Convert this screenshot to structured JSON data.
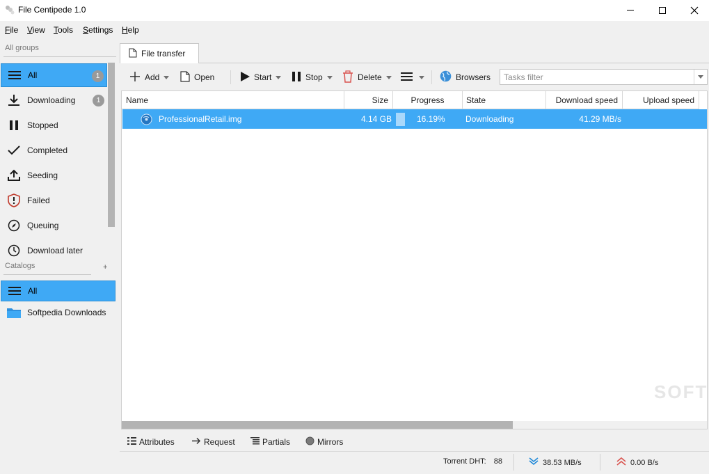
{
  "window": {
    "title": "File Centipede 1.0"
  },
  "menu": [
    {
      "label": "File",
      "accel": "F",
      "rest": "ile"
    },
    {
      "label": "View",
      "accel": "V",
      "rest": "iew"
    },
    {
      "label": "Tools",
      "accel": "T",
      "rest": "ools"
    },
    {
      "label": "Settings",
      "accel": "S",
      "rest": "ettings"
    },
    {
      "label": "Help",
      "accel": "H",
      "rest": "elp"
    }
  ],
  "sidebar": {
    "groups_title": "All groups",
    "groups": [
      {
        "label": "All",
        "icon": "list-icon",
        "badge": "1",
        "selected": true
      },
      {
        "label": "Downloading",
        "icon": "download-icon",
        "badge": "1"
      },
      {
        "label": "Stopped",
        "icon": "pause-icon"
      },
      {
        "label": "Completed",
        "icon": "check-icon"
      },
      {
        "label": "Seeding",
        "icon": "upload-icon"
      },
      {
        "label": "Failed",
        "icon": "shield-alert-icon"
      },
      {
        "label": "Queuing",
        "icon": "compass-icon"
      },
      {
        "label": "Download later",
        "icon": "clock-icon"
      }
    ],
    "catalogs_title": "Catalogs",
    "catalogs_add": "+",
    "catalogs": [
      {
        "label": "All",
        "icon": "list-icon",
        "selected": true
      },
      {
        "label": "Softpedia Downloads",
        "icon": "folder-icon"
      }
    ]
  },
  "tab": {
    "label": "File transfer"
  },
  "toolbar": {
    "add": "Add",
    "open": "Open",
    "start": "Start",
    "stop": "Stop",
    "delete": "Delete",
    "browsers": "Browsers",
    "filter_placeholder": "Tasks filter",
    "filter_value": ""
  },
  "table": {
    "columns": [
      "Name",
      "Size",
      "Progress",
      "State",
      "Download speed",
      "Upload speed"
    ],
    "rows": [
      {
        "name": "ProfessionalRetail.img",
        "size": "4.14 GB",
        "progress": "16.19%",
        "progress_fraction": 0.1619,
        "state": "Downloading",
        "download_speed": "41.29 MB/s",
        "upload_speed": ""
      }
    ]
  },
  "bottom_tabs": [
    "Attributes",
    "Request",
    "Partials",
    "Mirrors"
  ],
  "status": {
    "dht_label": "Torrent DHT:",
    "dht_value": "88",
    "down_speed": "38.53 MB/s",
    "up_speed": "0.00 B/s"
  },
  "colors": {
    "accent": "#3fa9f5",
    "badge": "#9a9a9a",
    "delete": "#d9534f",
    "down_arrow": "#1e88d8",
    "up_arrow": "#d9534f"
  }
}
